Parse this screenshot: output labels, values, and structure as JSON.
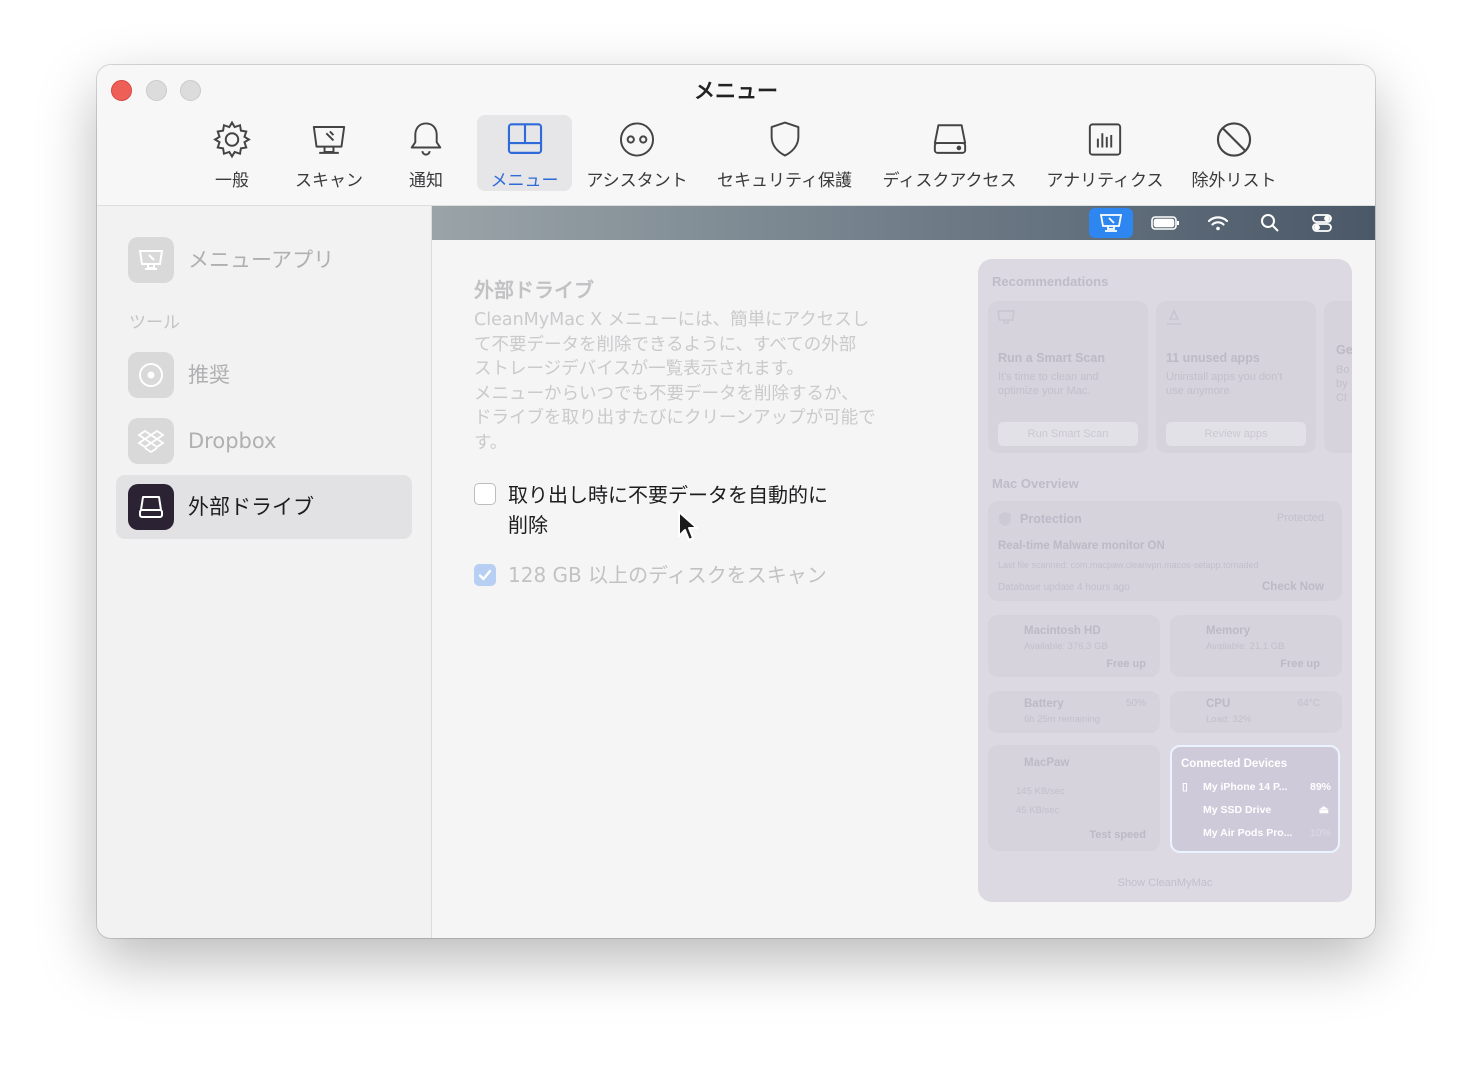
{
  "window": {
    "title": "メニュー"
  },
  "toolbar": [
    {
      "label": "一般",
      "icon": "gear-icon"
    },
    {
      "label": "スキャン",
      "icon": "monitor-icon"
    },
    {
      "label": "通知",
      "icon": "bell-icon"
    },
    {
      "label": "メニュー",
      "icon": "menu-layout-icon",
      "active": true
    },
    {
      "label": "アシスタント",
      "icon": "assistant-icon"
    },
    {
      "label": "セキュリティ保護",
      "icon": "shield-icon"
    },
    {
      "label": "ディスクアクセス",
      "icon": "disk-icon"
    },
    {
      "label": "アナリティクス",
      "icon": "chart-icon"
    },
    {
      "label": "除外リスト",
      "icon": "prohibited-icon"
    }
  ],
  "sidebar": {
    "top_item": {
      "label": "メニューアプリ",
      "icon": "monitor-icon"
    },
    "section_label": "ツール",
    "items": [
      {
        "label": "推奨",
        "icon": "recommend-icon"
      },
      {
        "label": "Dropbox",
        "icon": "dropbox-icon"
      },
      {
        "label": "外部ドライブ",
        "icon": "drive-icon",
        "active": true
      }
    ]
  },
  "content": {
    "title": "外部ドライブ",
    "description": "CleanMyMac X メニューには、簡単にアクセスし\nて不要データを削除できるように、すべての外部\nストレージデバイスが一覧表示されます。\nメニューからいつでも不要データを削除するか、\nドライブを取り出すたびにクリーンアップが可能で\nす。",
    "options": [
      {
        "label": "取り出し時に不要データを自動的に\n削除",
        "checked": false
      },
      {
        "label": "128 GB 以上のディスクをスキャン",
        "checked": true,
        "disabled": true
      }
    ]
  },
  "menubar_icons": [
    "cleanmymac-menu-icon",
    "battery-icon",
    "wifi-icon",
    "search-icon",
    "control-center-icon"
  ],
  "preview": {
    "recommendations_title": "Recommendations",
    "cards": [
      {
        "title": "Run a Smart Scan",
        "desc": "It's time to clean and\noptimize your Mac.",
        "button": "Run Smart Scan"
      },
      {
        "title": "11 unused apps",
        "desc": "Uninstall apps you don't\nuse anymore",
        "button": "Review apps"
      },
      {
        "title": "Ge",
        "desc": "Bo\nby\nCl",
        "button": ""
      }
    ],
    "overview_title": "Mac Overview",
    "protection": {
      "label": "Protection",
      "status": "Protected",
      "monitor": "Real-time Malware monitor ON",
      "last_file": "Last file scanned: com.macpaw.cleanvpn.macos-setapp.tornaded",
      "db_update": "Database update 4 hours ago",
      "action": "Check Now"
    },
    "disk": {
      "name": "Macintosh HD",
      "available": "Available: 376,3 GB",
      "action": "Free up"
    },
    "memory": {
      "name": "Memory",
      "available": "Available: 21,1 GB",
      "action": "Free up"
    },
    "battery": {
      "name": "Battery",
      "remaining": "6h 25m remaining",
      "percent": "50%"
    },
    "cpu": {
      "name": "CPU",
      "load": "Load: 32%",
      "temp": "64°C"
    },
    "network": {
      "name": "MacPaw",
      "up": "145 KB/sec",
      "down": "45 KB/sec",
      "action": "Test speed"
    },
    "connected": {
      "title": "Connected Devices",
      "devices": [
        {
          "name": "My iPhone 14 P...",
          "value": "89%"
        },
        {
          "name": "My SSD Drive",
          "value": "⏏"
        },
        {
          "name": "My Air Pods Pro...",
          "value": "10%"
        }
      ]
    },
    "footer": "Show CleanMyMac"
  }
}
